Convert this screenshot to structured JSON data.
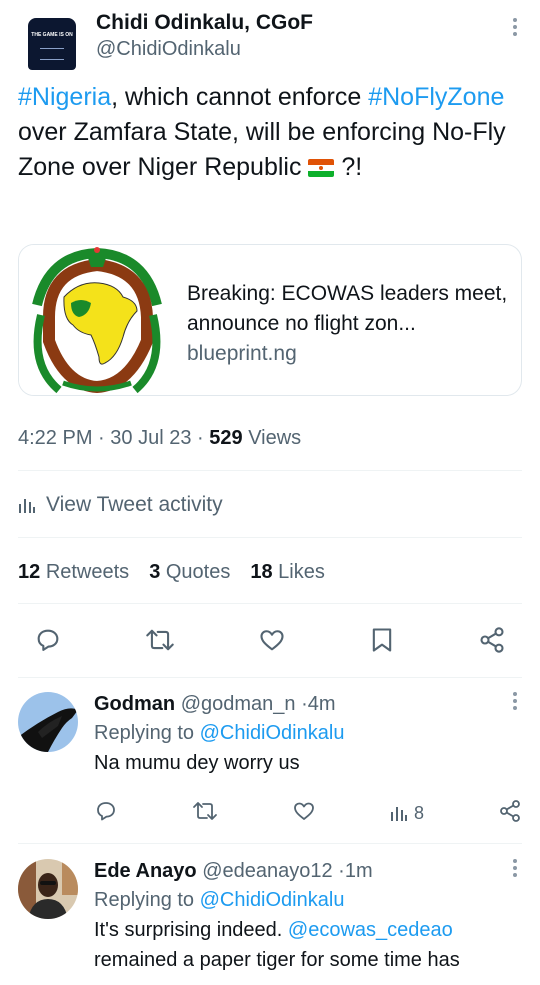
{
  "tweet": {
    "author_name": "Chidi Odinkalu, CGoF",
    "author_handle": "@ChidiOdinkalu",
    "avatar_shirt_text": "THE GAME IS ON",
    "text": {
      "hashtag1": "#Nigeria",
      "part1": ", which cannot enforce ",
      "hashtag2": "#NoFlyZone",
      "part2": " over Zamfara State, will be enforcing No-Fly Zone over Niger Republic ",
      "flag_icon": "niger-flag",
      "part3": " ?!"
    },
    "card": {
      "title": "Breaking: ECOWAS leaders meet, announce no flight zon...",
      "domain": "blueprint.ng",
      "image_icon": "ecowas-logo"
    },
    "time": "4:22 PM",
    "date": "30 Jul 23",
    "views_count": "529",
    "views_label": "Views",
    "sep": "·",
    "activity_label": "View Tweet activity",
    "retweets_count": "12",
    "retweets_label": "Retweets",
    "quotes_count": "3",
    "quotes_label": "Quotes",
    "likes_count": "18",
    "likes_label": "Likes",
    "action_icons": [
      "reply-icon",
      "retweet-icon",
      "like-icon",
      "bookmark-icon",
      "share-icon"
    ]
  },
  "replies": [
    {
      "name": "Godman",
      "handle": "@godman_n",
      "age": "4m",
      "replying_prefix": "Replying to",
      "replying_to": "@ChidiOdinkalu",
      "text": "Na mumu dey worry us",
      "views": "8"
    },
    {
      "name": "Ede Anayo",
      "handle": "@edeanayo12",
      "age": "1m",
      "replying_prefix": "Replying to",
      "replying_to": "@ChidiOdinkalu",
      "mention": "@ecowas_cedeao",
      "text_before": "It's surprising indeed. ",
      "text_after": " remained a paper tiger for some time has"
    }
  ],
  "colors": {
    "link": "#1d9bf0",
    "muted": "#536471",
    "text": "#0f1419",
    "divider": "#eff3f4"
  }
}
